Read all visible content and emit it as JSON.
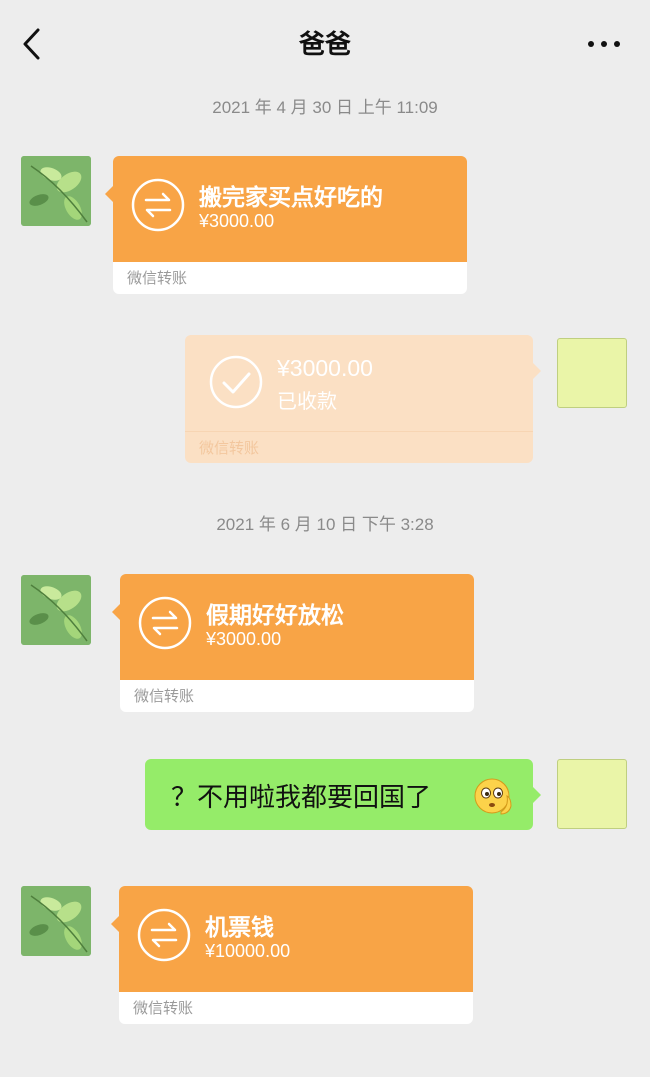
{
  "header": {
    "title": "爸爸",
    "back_icon": "chevron-left-icon",
    "more_icon": "more-dots-icon"
  },
  "messages": [
    {
      "timestamp": "2021 年 4 月 30 日  上午 11:09"
    },
    {
      "type": "transfer",
      "sender": "other",
      "title": "搬完家买点好吃的",
      "amount": "¥3000.00",
      "footer": "微信转账"
    },
    {
      "type": "transfer-received",
      "sender": "me",
      "amount": "¥3000.00",
      "status": "已收款",
      "footer": "微信转账"
    },
    {
      "timestamp": "2021 年 6 月 10 日  下午 3:28"
    },
    {
      "type": "transfer",
      "sender": "other",
      "title": "假期好好放松",
      "amount": "¥3000.00",
      "footer": "微信转账"
    },
    {
      "type": "text",
      "sender": "me",
      "text": "？不用啦我都要回国了",
      "emoji": "thinking-face-emoji"
    },
    {
      "type": "transfer",
      "sender": "other",
      "title": "机票钱",
      "amount": "¥10000.00",
      "footer": "微信转账"
    }
  ],
  "colors": {
    "background": "#ededed",
    "transfer_orange": "#f8a446",
    "transfer_received": "#fbe0c4",
    "text_bubble_green": "#95ec69"
  }
}
